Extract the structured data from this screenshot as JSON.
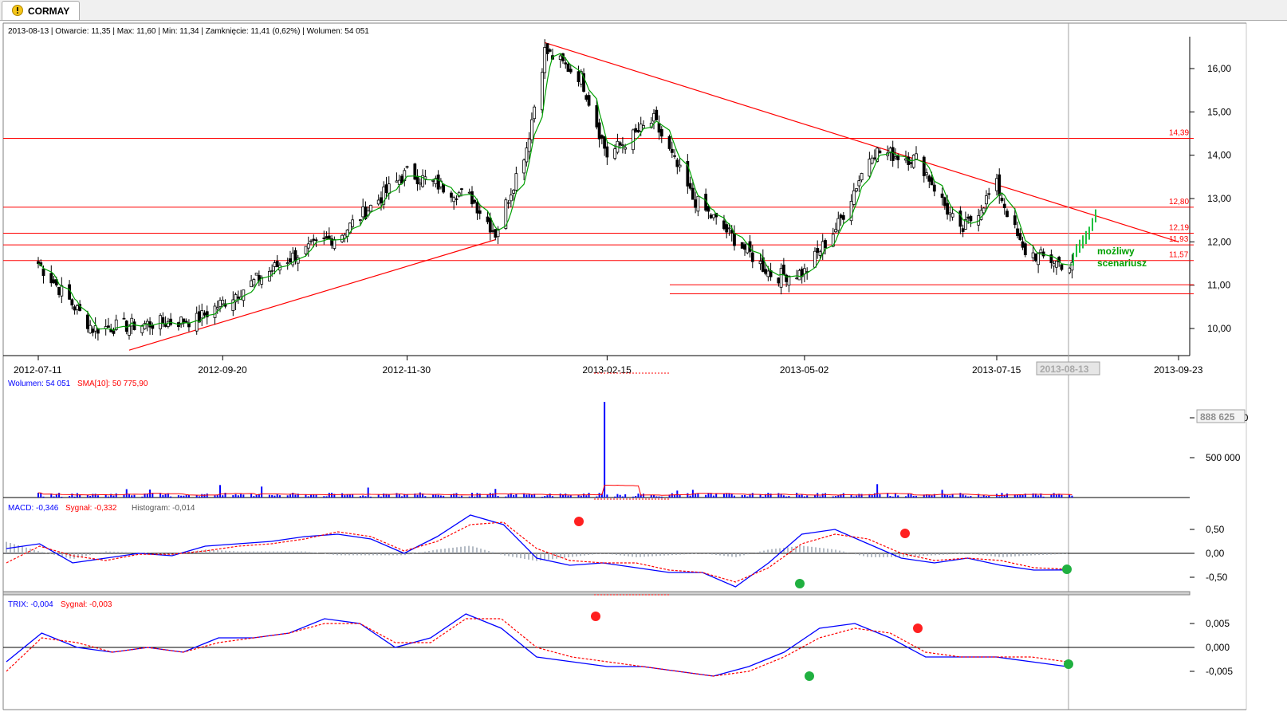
{
  "tab": {
    "title": "CORMAY"
  },
  "header": {
    "info": "2013-08-13 | Otwarcie: 11,35 | Max: 11,60 | Min: 11,34 | Zamknięcie: 11,41 (0,62%)  | Wolumen: 54 051"
  },
  "colors": {
    "bull": "#000000",
    "bear": "#000000",
    "sma": "#00a000",
    "level": "#ff0000",
    "trend": "#ff0000",
    "blue": "#0000ff",
    "red": "#ff0000",
    "green": "#00a000",
    "hist": "#a0a8b0",
    "cursor": "#a0a0a0"
  },
  "price_panel": {
    "y_ticks": [
      "10,00",
      "11,00",
      "12,00",
      "13,00",
      "14,00",
      "15,00",
      "16,00"
    ],
    "x_ticks": [
      "2012-07-11",
      "2012-09-20",
      "2012-11-30",
      "2013-02-15",
      "2013-05-02",
      "2013-07-15",
      "2013-09-23"
    ],
    "cursor_date": "2013-08-13",
    "scenario_label_1": "możliwy",
    "scenario_label_2": "scenariusz",
    "levels": [
      {
        "label": "14,39",
        "value": 14.39
      },
      {
        "label": "12,80",
        "value": 12.8
      },
      {
        "label": "12,19",
        "value": 12.2
      },
      {
        "label": "11,93",
        "value": 11.93
      },
      {
        "label": "11,57",
        "value": 11.57
      }
    ],
    "support_lines": [
      11.01,
      10.8
    ]
  },
  "volume_panel": {
    "header_label": "Wolumen: 54 051",
    "sma_label": "SMA[10]: 50 775,90",
    "y_ticks": [
      "500 000",
      "1 000 000"
    ],
    "box_value": "888 625"
  },
  "macd_panel": {
    "macd_label": "MACD: -0,346",
    "signal_label": "Sygnał: -0,332",
    "hist_label": "Histogram: -0,014",
    "y_ticks": [
      "0,50",
      "0,00",
      "-0,50"
    ]
  },
  "trix_panel": {
    "trix_label": "TRIX: -0,004",
    "signal_label": "Sygnał: -0,003",
    "y_ticks": [
      "0,005",
      "0,000",
      "-0,005"
    ]
  },
  "chart_data": [
    {
      "type": "candlestick",
      "title": "CORMAY",
      "x_range": [
        "2012-07-11",
        "2013-09-23"
      ],
      "ylim": [
        9.4,
        16.8
      ],
      "key_points": [
        {
          "date": "2012-07-11",
          "close": 11.5
        },
        {
          "date": "2012-08-01",
          "close": 10.0
        },
        {
          "date": "2012-09-10",
          "close": 10.2
        },
        {
          "date": "2012-10-15",
          "close": 11.6
        },
        {
          "date": "2012-11-05",
          "close": 12.2
        },
        {
          "date": "2012-11-30",
          "close": 13.6
        },
        {
          "date": "2012-12-25",
          "close": 13.0
        },
        {
          "date": "2013-01-03",
          "close": 12.2
        },
        {
          "date": "2013-01-15",
          "close": 14.2
        },
        {
          "date": "2013-01-22",
          "close": 16.4
        },
        {
          "date": "2013-02-05",
          "close": 15.8
        },
        {
          "date": "2013-02-15",
          "close": 14.0
        },
        {
          "date": "2013-03-05",
          "close": 14.8
        },
        {
          "date": "2013-03-20",
          "close": 13.0
        },
        {
          "date": "2013-04-20",
          "close": 11.2
        },
        {
          "date": "2013-05-02",
          "close": 11.3
        },
        {
          "date": "2013-05-15",
          "close": 12.4
        },
        {
          "date": "2013-05-28",
          "close": 14.1
        },
        {
          "date": "2013-06-15",
          "close": 13.9
        },
        {
          "date": "2013-07-01",
          "close": 12.2
        },
        {
          "date": "2013-07-15",
          "close": 13.3
        },
        {
          "date": "2013-07-25",
          "close": 11.8
        },
        {
          "date": "2013-08-13",
          "close": 11.41
        }
      ],
      "scenario": [
        11.6,
        11.8,
        11.9,
        12.0,
        12.1,
        12.2,
        12.4,
        12.6
      ],
      "sma_series": "SMA",
      "trend_lines": [
        {
          "from": {
            "date": "2012-08-15",
            "price": 9.5
          },
          "to": {
            "date": "2013-01-03",
            "price": 12.05
          }
        },
        {
          "from": {
            "date": "2013-01-22",
            "price": 16.6
          },
          "to": {
            "date": "2013-09-23",
            "price": 12.0
          }
        }
      ]
    },
    {
      "type": "bar",
      "series": [
        {
          "name": "Wolumen",
          "note": "daily volume"
        },
        {
          "name": "SMA[10]"
        }
      ],
      "peaks": [
        {
          "date": "2013-02-14",
          "value": 1200000
        }
      ],
      "ylim": [
        0,
        1250000
      ]
    },
    {
      "type": "line",
      "series": [
        {
          "name": "MACD",
          "values": [
            0.1,
            0.2,
            -0.2,
            -0.1,
            0.0,
            -0.05,
            0.15,
            0.2,
            0.25,
            0.35,
            0.4,
            0.3,
            0.0,
            0.35,
            0.8,
            0.6,
            -0.1,
            -0.25,
            -0.2,
            -0.3,
            -0.4,
            -0.4,
            -0.7,
            -0.2,
            0.4,
            0.5,
            0.2,
            -0.1,
            -0.2,
            -0.1,
            -0.25,
            -0.35,
            -0.346
          ]
        },
        {
          "name": "Sygnał",
          "values": [
            -0.2,
            0.15,
            -0.05,
            -0.15,
            -0.02,
            -0.02,
            0.05,
            0.15,
            0.2,
            0.3,
            0.45,
            0.35,
            0.05,
            0.25,
            0.6,
            0.65,
            0.1,
            -0.15,
            -0.2,
            -0.2,
            -0.35,
            -0.4,
            -0.6,
            -0.3,
            0.2,
            0.4,
            0.3,
            0.0,
            -0.15,
            -0.1,
            -0.15,
            -0.3,
            -0.332
          ]
        }
      ],
      "ylim": [
        -0.65,
        0.65
      ]
    },
    {
      "type": "line",
      "series": [
        {
          "name": "TRIX",
          "values": [
            -0.003,
            0.003,
            0.0,
            -0.001,
            0.0,
            -0.001,
            0.002,
            0.002,
            0.003,
            0.006,
            0.005,
            0.0,
            0.002,
            0.007,
            0.004,
            -0.002,
            -0.003,
            -0.004,
            -0.004,
            -0.005,
            -0.006,
            -0.004,
            -0.001,
            0.004,
            0.005,
            0.002,
            -0.002,
            -0.002,
            -0.002,
            -0.003,
            -0.004
          ]
        },
        {
          "name": "Sygnał",
          "values": [
            -0.005,
            0.002,
            0.001,
            -0.001,
            0.0,
            -0.001,
            0.001,
            0.002,
            0.003,
            0.005,
            0.005,
            0.001,
            0.001,
            0.006,
            0.006,
            0.0,
            -0.002,
            -0.003,
            -0.004,
            -0.005,
            -0.006,
            -0.005,
            -0.002,
            0.002,
            0.004,
            0.003,
            -0.001,
            -0.002,
            -0.002,
            -0.002,
            -0.003
          ]
        }
      ],
      "ylim": [
        -0.0065,
        0.0085
      ]
    }
  ]
}
